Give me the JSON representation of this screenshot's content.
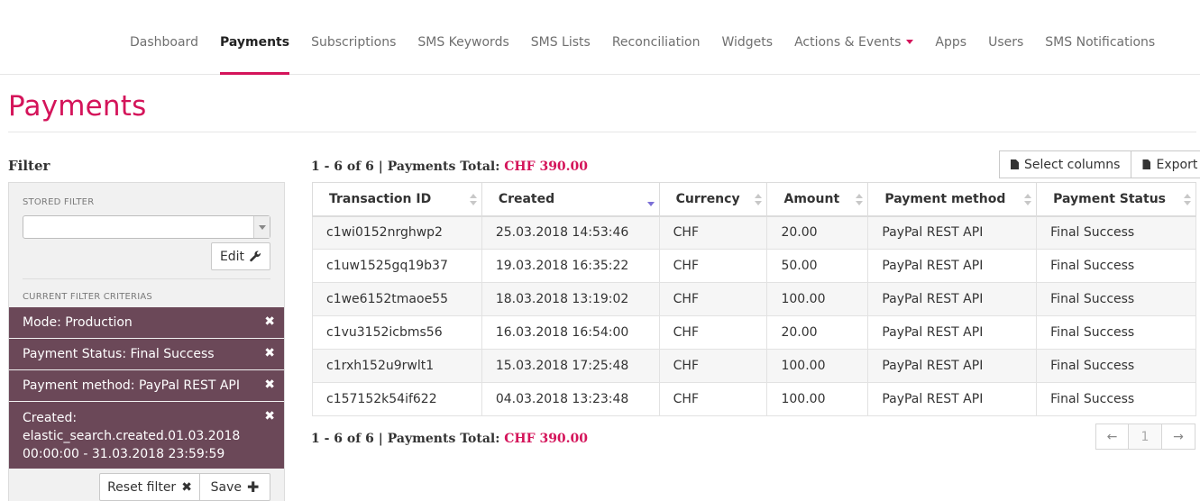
{
  "nav": {
    "items": [
      {
        "label": "Dashboard"
      },
      {
        "label": "Payments"
      },
      {
        "label": "Subscriptions"
      },
      {
        "label": "SMS Keywords"
      },
      {
        "label": "SMS Lists"
      },
      {
        "label": "Reconciliation"
      },
      {
        "label": "Widgets"
      },
      {
        "label": "Actions & Events"
      },
      {
        "label": "Apps"
      },
      {
        "label": "Users"
      },
      {
        "label": "SMS Notifications"
      }
    ],
    "active": "Payments"
  },
  "page": {
    "title": "Payments"
  },
  "filter": {
    "heading": "Filter",
    "stored_label": "STORED FILTER",
    "stored_value": "",
    "edit_label": "Edit",
    "criteria_label": "CURRENT FILTER CRITERIAS",
    "criteria": [
      {
        "text": "Mode: Production"
      },
      {
        "text": "Payment Status: Final Success"
      },
      {
        "text": "Payment method: PayPal REST API"
      },
      {
        "text": "Created: elastic_search.created.01.03.2018 00:00:00 - 31.03.2018 23:59:59"
      }
    ],
    "reset_label": "Reset filter",
    "save_label": "Save"
  },
  "results": {
    "summary_prefix": "1 - 6 of 6 | Payments Total: ",
    "summary_amount": "CHF 390.00",
    "select_columns_label": "Select columns",
    "export_label": "Export",
    "columns": [
      "Transaction ID",
      "Created",
      "Currency",
      "Amount",
      "Payment method",
      "Payment Status"
    ],
    "rows": [
      [
        "c1wi0152nrghwp2",
        "25.03.2018 14:53:46",
        "CHF",
        "20.00",
        "PayPal REST API",
        "Final Success"
      ],
      [
        "c1uw1525gq19b37",
        "19.03.2018 16:35:22",
        "CHF",
        "50.00",
        "PayPal REST API",
        "Final Success"
      ],
      [
        "c1we6152tmaoe55",
        "18.03.2018 13:19:02",
        "CHF",
        "100.00",
        "PayPal REST API",
        "Final Success"
      ],
      [
        "c1vu3152icbms56",
        "16.03.2018 16:54:00",
        "CHF",
        "20.00",
        "PayPal REST API",
        "Final Success"
      ],
      [
        "c1rxh152u9rwlt1",
        "15.03.2018 17:25:48",
        "CHF",
        "100.00",
        "PayPal REST API",
        "Final Success"
      ],
      [
        "c157152k54if622",
        "04.03.2018 13:23:48",
        "CHF",
        "100.00",
        "PayPal REST API",
        "Final Success"
      ]
    ],
    "sorted_column": "Created",
    "sort_direction": "desc"
  },
  "pager": {
    "prev": "←",
    "current": "1",
    "next": "→"
  },
  "colors": {
    "accent": "#d4145a",
    "criteria_bg": "#6b4858",
    "sort_active": "#7b6fd6"
  }
}
